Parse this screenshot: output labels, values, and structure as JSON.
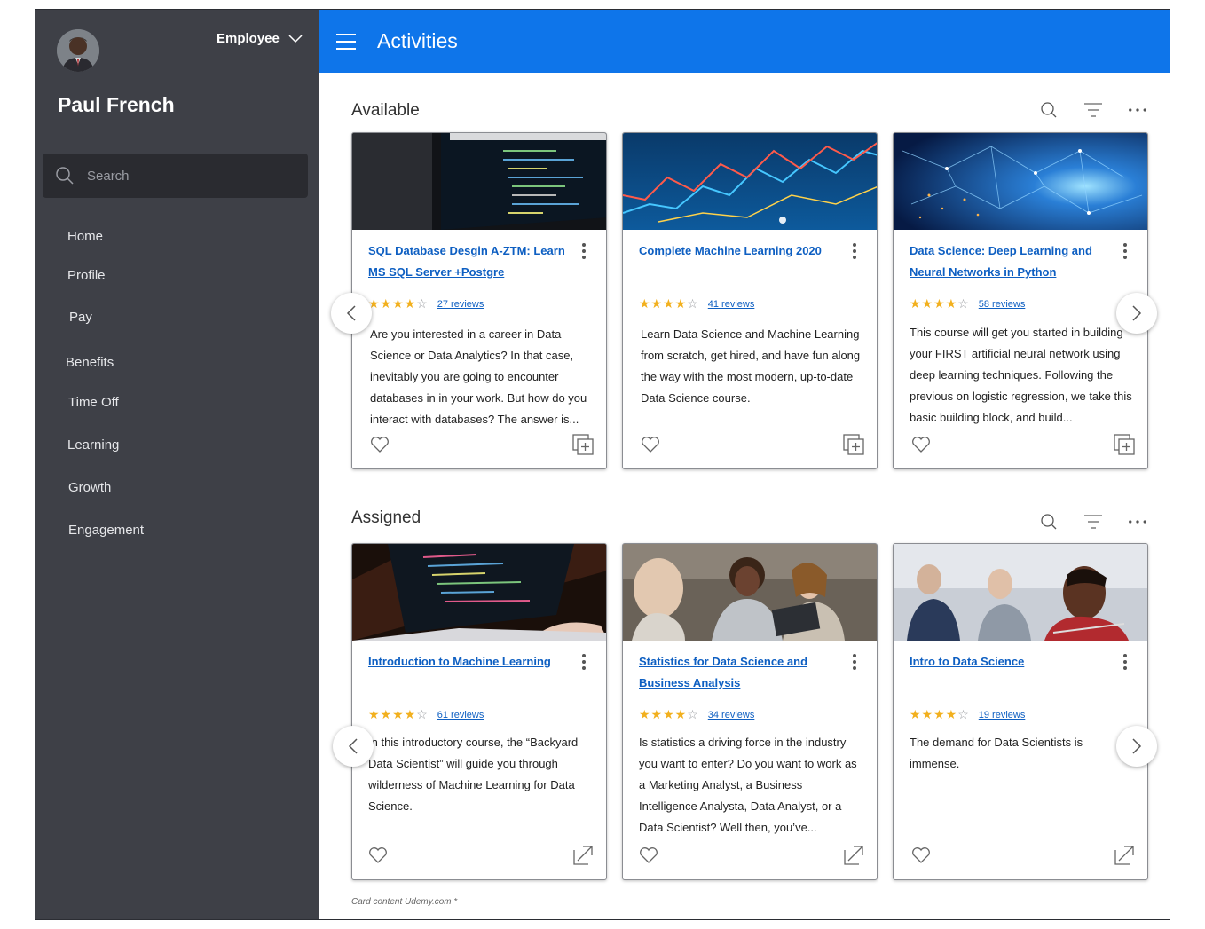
{
  "user": {
    "name": "Paul French",
    "role": "Employee"
  },
  "search": {
    "placeholder": "Search"
  },
  "nav": [
    "Home",
    "Profile",
    "Pay",
    "Benefits",
    "Time Off",
    "Learning",
    "Growth",
    "Engagement"
  ],
  "header": {
    "title": "Activities"
  },
  "sections": {
    "available": {
      "title": "Available",
      "cards": [
        {
          "title": "SQL Database Desgin A-ZTM: Learn MS SQL Server +Postgre",
          "rating": 4,
          "reviews": "27 reviews",
          "description": "Are you interested in a career in Data Science or Data Analytics? In that case, inevitably you are going to encounter databases in in your work. But how do you interact with databases? The answer is...",
          "image": "code-screen"
        },
        {
          "title": "Complete Machine Learning 2020",
          "rating": 4,
          "reviews": "41 reviews",
          "description": "Learn Data Science and Machine Learning from scratch, get hired, and have fun along the way with the most modern, up-to-date Data Science course.",
          "image": "stock-chart"
        },
        {
          "title": "Data Science: Deep Learning and Neural Networks in Python",
          "rating": 4,
          "reviews": "58 reviews",
          "description": "This course will get you started in building your FIRST artificial neural network using deep learning techniques. Following the previous on logistic regression, we take this basic building block, and build...",
          "image": "network-globe"
        }
      ]
    },
    "assigned": {
      "title": "Assigned",
      "cards": [
        {
          "title": "Introduction to Machine Learning",
          "rating": 4,
          "reviews": "61 reviews",
          "description": "In this introductory course, the “Backyard Data Scientist” will guide you through wilderness of Machine Learning for Data Science.",
          "image": "laptop-code"
        },
        {
          "title": "Statistics for Data Science and Business Analysis",
          "rating": 4,
          "reviews": "34 reviews",
          "description": "Is statistics a driving force in the industry you want to enter? Do you want to work as a Marketing Analyst, a Business Intelligence Analysta, Data Analyst, or a Data Scientist? Well then, you’ve...",
          "image": "office-people"
        },
        {
          "title": "Intro to Data Science",
          "rating": 4,
          "reviews": "19 reviews",
          "description": "The demand for Data Scientists is immense.",
          "image": "students"
        }
      ]
    }
  },
  "footnote": "Card content Udemy.com *",
  "colors": {
    "sidebar": "#3e4047",
    "header": "#0e75ea",
    "link": "#0e5fc2",
    "star": "#f2b01e"
  },
  "icons": [
    "search-icon",
    "filter-icon",
    "more-icon",
    "heart-icon",
    "add-to-list-icon",
    "external-link-icon",
    "chevron-left-icon",
    "chevron-right-icon",
    "hamburger-icon",
    "chevron-down-icon"
  ]
}
